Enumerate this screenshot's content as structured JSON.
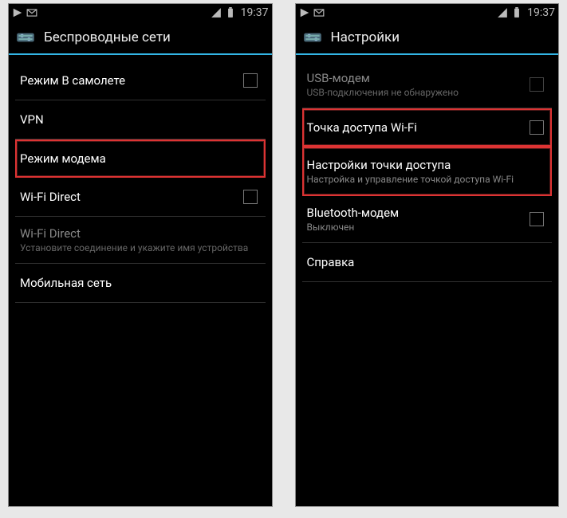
{
  "status": {
    "time": "19:37"
  },
  "phoneA": {
    "title": "Беспроводные сети",
    "items": [
      {
        "title": "Режим В самолете",
        "checkbox": true
      },
      {
        "title": "VPN"
      },
      {
        "title": "Режим модема",
        "highlighted": true
      },
      {
        "title": "Wi-Fi Direct",
        "checkbox": true
      },
      {
        "title": "Wi-Fi Direct",
        "sub": "Установите соединение и укажите имя устройства",
        "disabled": true
      },
      {
        "title": "Мобильная сеть"
      }
    ]
  },
  "phoneB": {
    "title": "Настройки",
    "items": [
      {
        "title": "USB-модем",
        "sub": "USB-подключения не обнаружено",
        "checkbox": true,
        "disabled": true
      },
      {
        "title": "Точка доступа Wi-Fi",
        "checkbox": true,
        "highlighted": true
      },
      {
        "title": "Настройки точки доступа",
        "sub": "Настройка и управление точкой доступа Wi-Fi",
        "highlighted": true
      },
      {
        "title": "Bluetooth-модем",
        "sub": "Выключен",
        "checkbox": true
      },
      {
        "title": "Справка"
      }
    ]
  }
}
